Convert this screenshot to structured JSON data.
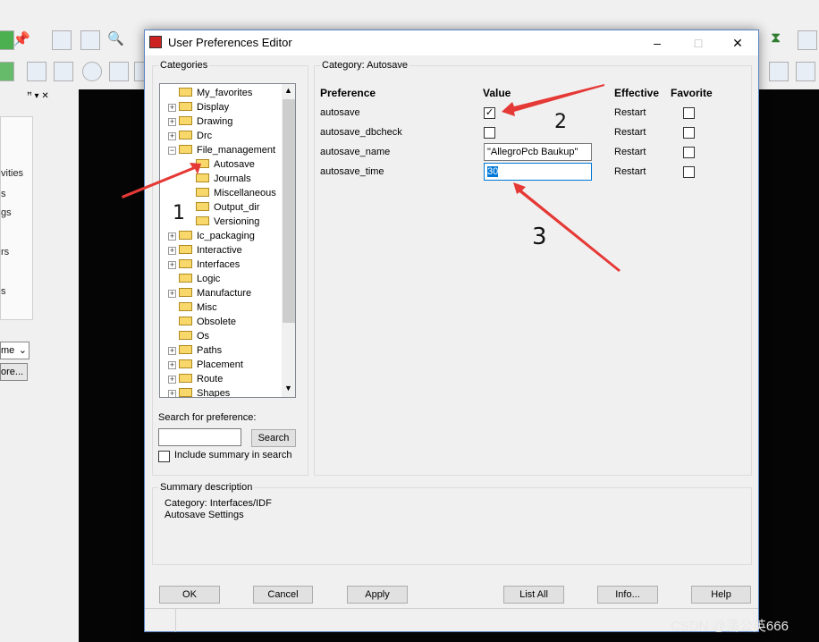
{
  "background": {
    "left_panel_fragments": [
      "vities",
      "s",
      "gs",
      "rs",
      "s"
    ],
    "dropdown_value": "me",
    "more_button": "ore..."
  },
  "dialog": {
    "title": "User Preferences Editor",
    "window_controls": {
      "minimize": "–",
      "maximize": "□",
      "close": "✕"
    },
    "categories_label": "Categories",
    "tree": [
      {
        "label": "My_favorites",
        "expander": ""
      },
      {
        "label": "Display",
        "expander": "+"
      },
      {
        "label": "Drawing",
        "expander": "+"
      },
      {
        "label": "Drc",
        "expander": "+"
      },
      {
        "label": "File_management",
        "expander": "−"
      },
      {
        "label": "Autosave",
        "child": true,
        "selected": true
      },
      {
        "label": "Journals",
        "child": true
      },
      {
        "label": "Miscellaneous",
        "child": true
      },
      {
        "label": "Output_dir",
        "child": true
      },
      {
        "label": "Versioning",
        "child": true
      },
      {
        "label": "Ic_packaging",
        "expander": "+"
      },
      {
        "label": "Interactive",
        "expander": "+"
      },
      {
        "label": "Interfaces",
        "expander": "+"
      },
      {
        "label": "Logic",
        "expander": ""
      },
      {
        "label": "Manufacture",
        "expander": "+"
      },
      {
        "label": "Misc",
        "expander": ""
      },
      {
        "label": "Obsolete",
        "expander": ""
      },
      {
        "label": "Os",
        "expander": ""
      },
      {
        "label": "Paths",
        "expander": "+"
      },
      {
        "label": "Placement",
        "expander": "+"
      },
      {
        "label": "Route",
        "expander": "+"
      },
      {
        "label": "Shapes",
        "expander": "+"
      }
    ],
    "search_label": "Search for preference:",
    "search_value": "",
    "search_button": "Search",
    "include_summary_label": "Include summary in search",
    "category_legend": "Category:  Autosave",
    "columns": {
      "preference": "Preference",
      "value": "Value",
      "effective": "Effective",
      "favorite": "Favorite"
    },
    "rows": [
      {
        "preference": "autosave",
        "value_type": "checkbox",
        "checked": true,
        "effective": "Restart"
      },
      {
        "preference": "autosave_dbcheck",
        "value_type": "checkbox",
        "checked": false,
        "effective": "Restart"
      },
      {
        "preference": "autosave_name",
        "value_type": "text",
        "value": "\"AllegroPcb Baukup\"",
        "effective": "Restart"
      },
      {
        "preference": "autosave_time",
        "value_type": "text",
        "value": "30",
        "effective": "Restart"
      }
    ],
    "summary_legend": "Summary description",
    "summary_lines": [
      "Category: Interfaces/IDF",
      "Autosave Settings"
    ],
    "buttons": {
      "ok": "OK",
      "cancel": "Cancel",
      "apply": "Apply",
      "list_all": "List All",
      "info": "Info...",
      "help": "Help"
    }
  },
  "annotations": [
    "1",
    "2",
    "3"
  ],
  "watermark": "CSDN @蒲公英666",
  "colors": {
    "arrow": "#e53935",
    "selection": "#0078d7",
    "canvas": "#050505"
  }
}
